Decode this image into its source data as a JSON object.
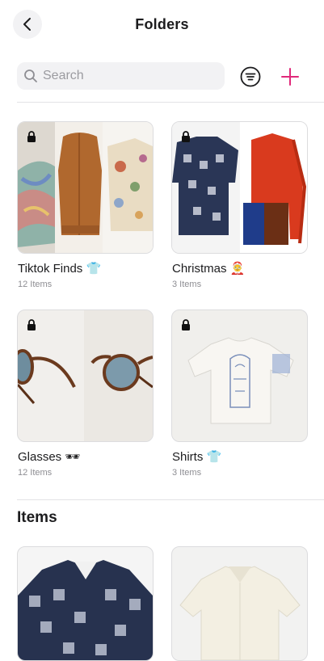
{
  "header": {
    "title": "Folders"
  },
  "search": {
    "placeholder": "Search"
  },
  "folders": [
    {
      "name": "Tiktok Finds",
      "emoji": "👕",
      "count": "12 Items"
    },
    {
      "name": "Christmas",
      "emoji": "🤶",
      "count": "3 Items"
    },
    {
      "name": "Glasses",
      "emoji": "🕶",
      "count": "12 Items"
    },
    {
      "name": "Shirts",
      "emoji": "👕",
      "count": "3 Items"
    }
  ],
  "items_section": {
    "title": "Items"
  },
  "icons": {
    "back": "chevron-left-icon",
    "search": "search-icon",
    "filter": "filter-icon",
    "add": "plus-icon",
    "lock": "lock-icon"
  },
  "colors": {
    "accent": "#e0297a",
    "search_bg": "#f2f2f4",
    "divider": "#e3e3e6"
  }
}
